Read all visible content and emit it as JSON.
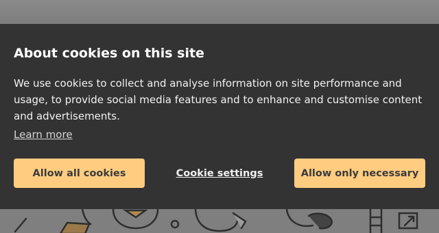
{
  "cookie_banner": {
    "title": "About cookies on this site",
    "description": "We use cookies to collect and analyse information on site performance and usage, to provide social media features and to enhance and customise content and advertisements.",
    "learn_more_label": "Learn more",
    "buttons": {
      "allow_all_label": "Allow all cookies",
      "settings_label": "Cookie settings",
      "necessary_label": "Allow only necessary"
    }
  },
  "colors": {
    "banner_background": "#333333",
    "button_accent": "#ffcc80",
    "overlay": "#7a7a7a"
  }
}
